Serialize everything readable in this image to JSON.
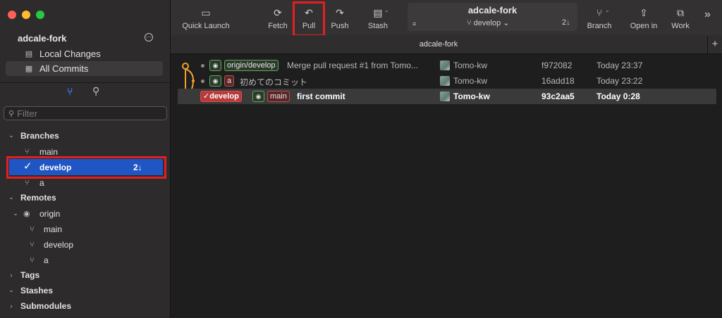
{
  "sidebar": {
    "repo_name": "adcale-fork",
    "nav": {
      "local_changes": "Local Changes",
      "all_commits": "All Commits"
    },
    "filter_placeholder": "Filter",
    "sections": {
      "branches": "Branches",
      "remotes": "Remotes",
      "tags": "Tags",
      "stashes": "Stashes",
      "submodules": "Submodules"
    },
    "branches": [
      {
        "name": "main"
      },
      {
        "name": "develop",
        "count": "2↓",
        "selected": true
      },
      {
        "name": "a"
      }
    ],
    "remote": {
      "name": "origin",
      "branches": [
        "main",
        "develop",
        "a"
      ]
    }
  },
  "toolbar": {
    "quick_launch": "Quick Launch",
    "fetch": "Fetch",
    "pull": "Pull",
    "push": "Push",
    "stash": "Stash",
    "branch": "Branch",
    "open_in": "Open in",
    "work": "Work",
    "repo": {
      "title": "adcale-fork",
      "branch": "develop",
      "count": "2↓"
    }
  },
  "tab": {
    "label": "adcale-fork"
  },
  "commits": [
    {
      "tags": [
        "origin/develop"
      ],
      "message": "Merge pull request #1 from Tomo...",
      "author": "Tomo-kw",
      "hash": "f972082",
      "date": "Today 23:37"
    },
    {
      "tags": [
        "a"
      ],
      "message": "初めてのコミット",
      "author": "Tomo-kw",
      "hash": "16add18",
      "date": "Today 23:22"
    },
    {
      "tags": [
        "develop",
        "main"
      ],
      "message": "first commit",
      "author": "Tomo-kw",
      "hash": "93c2aa5",
      "date": "Today 0:28",
      "selected": true
    }
  ],
  "colors": {
    "selection_blue": "#2055c4",
    "highlight_red": "#e22020",
    "graph_orange": "#f0a030"
  }
}
